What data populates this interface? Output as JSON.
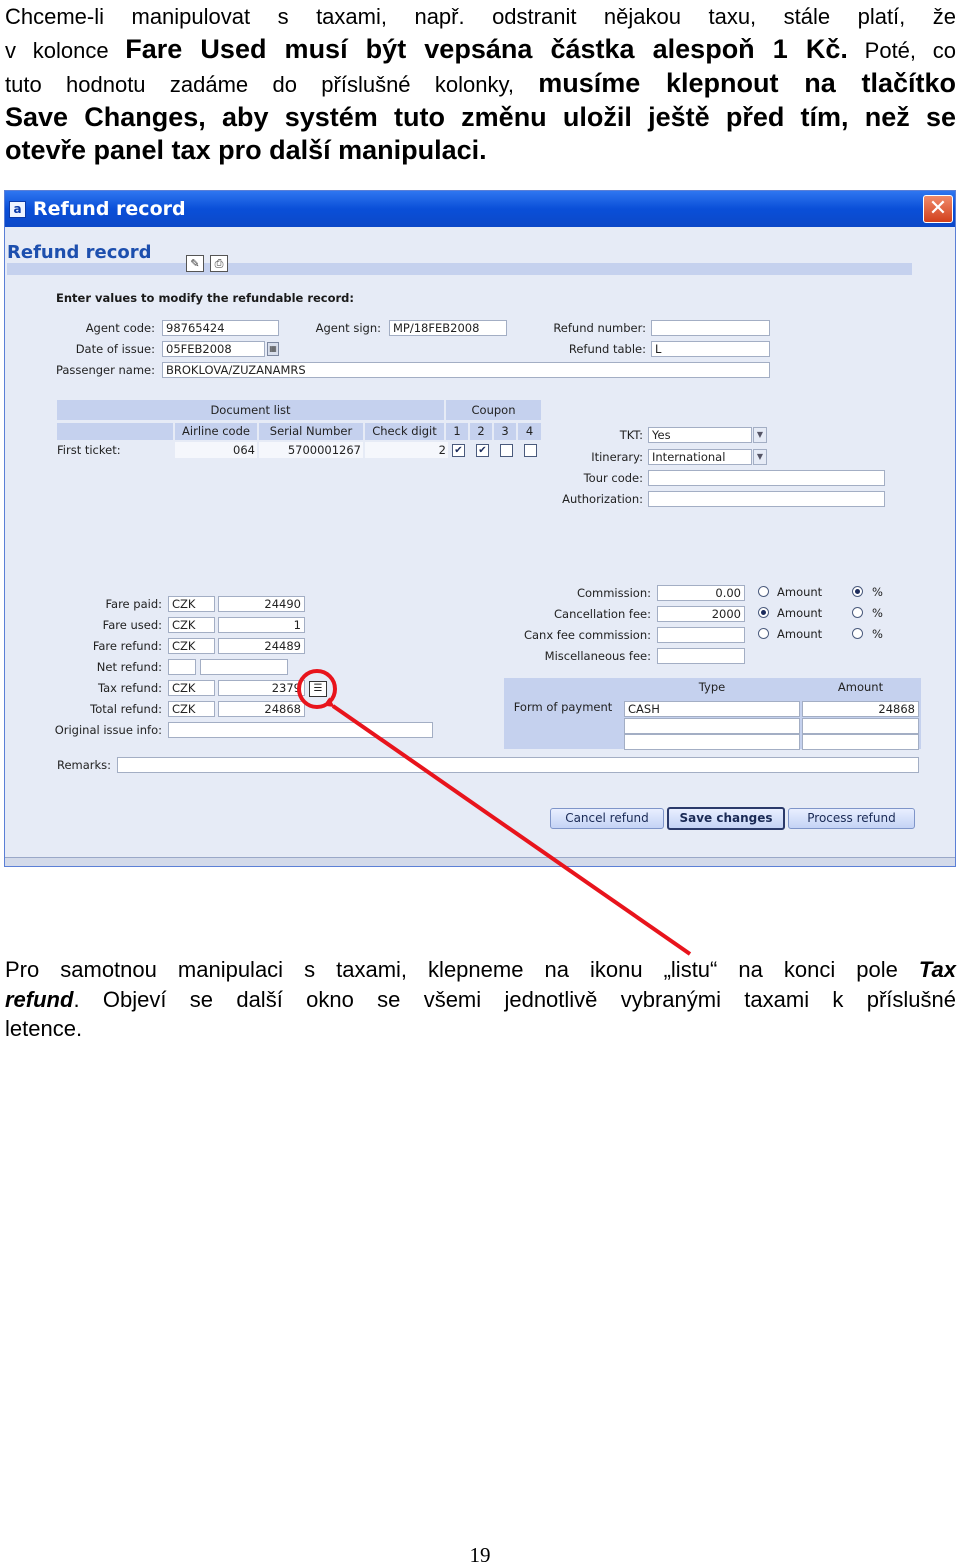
{
  "doc": {
    "p1": {
      "l1": "Chceme-li manipulovat s taxami, např. odstranit nějakou taxu, stále platí, že",
      "l2a": "v kolonce ",
      "l2b": "Fare Used musí být vepsána částka alespoň 1 Kč.",
      "l2c": " Poté, co",
      "l3a": "tuto hodnotu zadáme do příslušné kolonky, ",
      "l3b": "musíme klepnout na tlačítko",
      "l4": "Save Changes, aby systém tuto změnu uložil ještě před tím, než se",
      "l5": "otevře panel tax pro další manipulaci."
    },
    "p2": {
      "l1a": "Pro samotnou manipulaci s taxami, klepneme na ikonu „listu“ na konci pole ",
      "l1b": "Tax",
      "l2a": "refund",
      "l2b": ". Objeví se další okno se všemi jednotlivě vybranými taxami k příslušné",
      "l3": "letence."
    },
    "page_number": "19"
  },
  "window": {
    "title": "Refund record",
    "close_glyph": "✕",
    "app_icon_glyph": "a",
    "header_title": "Refund record",
    "subhead": "Enter values to modify the refundable record:",
    "fields": {
      "agent_code_label": "Agent code:",
      "agent_code": "98765424",
      "agent_sign_label": "Agent sign:",
      "agent_sign": "MP/18FEB2008",
      "refund_number_label": "Refund number:",
      "refund_number": "",
      "date_of_issue_label": "Date of issue:",
      "date_of_issue": "05FEB2008",
      "refund_table_label": "Refund table:",
      "refund_table": "L",
      "passenger_name_label": "Passenger name:",
      "passenger_name": "BROKLOVA/ZUZANAMRS"
    },
    "grid": {
      "document_list": "Document list",
      "coupon": "Coupon",
      "airline_code": "Airline code",
      "serial_number": "Serial Number",
      "check_digit": "Check digit",
      "coupons": [
        "1",
        "2",
        "3",
        "4"
      ],
      "row_label": "First ticket:",
      "row_airline": "064",
      "row_serial": "5700001267",
      "row_check": "2",
      "coupon_checked": [
        true,
        true,
        false,
        false
      ]
    },
    "right_top": {
      "tkt_label": "TKT:",
      "tkt": "Yes",
      "itinerary_label": "Itinerary:",
      "itinerary": "International",
      "tour_code_label": "Tour code:",
      "tour_code": "",
      "authorization_label": "Authorization:",
      "authorization": ""
    },
    "fares": {
      "fare_paid_label": "Fare paid:",
      "fare_paid_cur": "CZK",
      "fare_paid": "24490",
      "fare_used_label": "Fare used:",
      "fare_used_cur": "CZK",
      "fare_used": "1",
      "fare_refund_label": "Fare refund:",
      "fare_refund_cur": "CZK",
      "fare_refund": "24489",
      "net_refund_label": "Net refund:",
      "tax_refund_label": "Tax refund:",
      "tax_refund_cur": "CZK",
      "tax_refund": "2379",
      "total_refund_label": "Total refund:",
      "total_refund_cur": "CZK",
      "total_refund": "24868",
      "original_issue_label": "Original issue info:"
    },
    "fees": {
      "commission_label": "Commission:",
      "commission": "0.00",
      "cancellation_fee_label": "Cancellation fee:",
      "cancellation_fee": "2000",
      "canx_fee_commission_label": "Canx fee commission:",
      "canx_fee_commission": "",
      "misc_fee_label": "Miscellaneous fee:",
      "amount_label": "Amount",
      "percent_label": "%"
    },
    "payment": {
      "form_label": "Form of payment",
      "type_header": "Type",
      "amount_header": "Amount",
      "type": "CASH",
      "amount": "24868"
    },
    "remarks_label": "Remarks:",
    "buttons": {
      "cancel": "Cancel refund",
      "save": "Save changes",
      "process": "Process refund"
    },
    "icons": {
      "list_glyph": "☰",
      "edit_glyph": "✎",
      "print_glyph": "⎙",
      "calendar_glyph": "▦",
      "dropdown_glyph": "▼",
      "check_glyph": "✔"
    }
  },
  "annotation_color": "#e8141c"
}
